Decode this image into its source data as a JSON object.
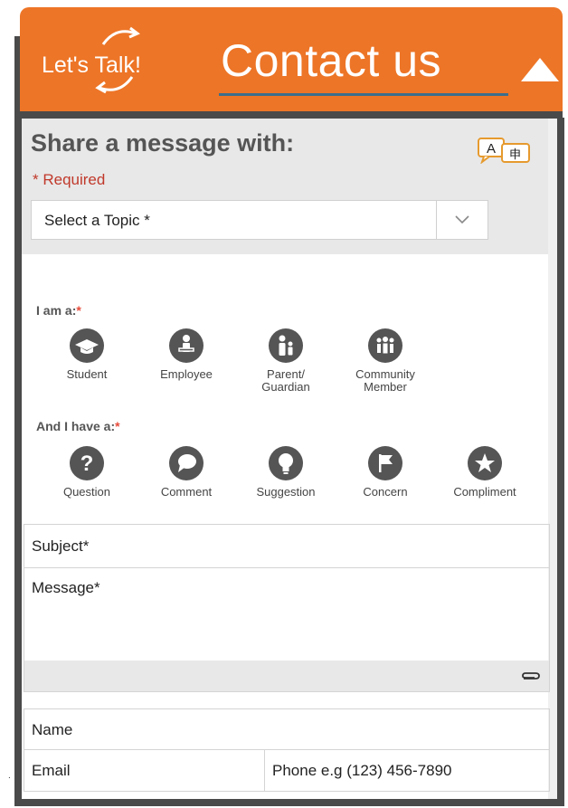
{
  "header": {
    "logo_text": "Let's Talk!",
    "title": "Contact us",
    "collapse_icon": "triangle-up-icon",
    "brand_color": "#ed7527"
  },
  "form": {
    "heading": "Share a message with:",
    "required_label": "* Required",
    "translate_icon": "translate-icon",
    "topic_select": {
      "selected": "Select a Topic *",
      "icon": "chevron-down-icon"
    },
    "role_group": {
      "label": "I am a:",
      "options": [
        {
          "label": "Student",
          "icon": "graduation-cap-icon"
        },
        {
          "label": "Employee",
          "icon": "employee-icon"
        },
        {
          "label": "Parent/\nGuardian",
          "icon": "parent-child-icon"
        },
        {
          "label": "Community\nMember",
          "icon": "people-group-icon"
        }
      ]
    },
    "type_group": {
      "label": "And I have a:",
      "options": [
        {
          "label": "Question",
          "icon": "question-icon"
        },
        {
          "label": "Comment",
          "icon": "speech-bubble-icon"
        },
        {
          "label": "Suggestion",
          "icon": "lightbulb-icon"
        },
        {
          "label": "Concern",
          "icon": "flag-icon"
        },
        {
          "label": "Compliment",
          "icon": "star-icon"
        }
      ]
    },
    "subject_placeholder": "Subject*",
    "message_placeholder": "Message*",
    "attach_icon": "paperclip-icon",
    "name_placeholder": "Name",
    "email_placeholder": "Email",
    "phone_placeholder": "Phone e.g (123) 456-7890"
  }
}
